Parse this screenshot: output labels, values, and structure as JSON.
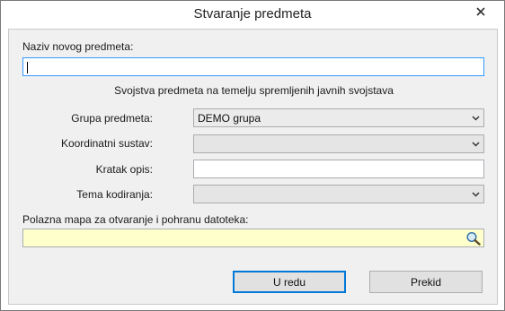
{
  "window": {
    "title": "Stvaranje predmeta"
  },
  "form": {
    "name_label": "Naziv novog predmeta:",
    "name_value": "",
    "properties_heading": "Svojstva predmeta na temelju spremljenih javnih svojstava",
    "group_label": "Grupa predmeta:",
    "group_value": "DEMO grupa",
    "coordinate_label": "Koordinatni sustav:",
    "coordinate_value": "",
    "description_label": "Kratak opis:",
    "description_value": "",
    "coding_label": "Tema kodiranja:",
    "coding_value": "",
    "folder_label": "Polazna mapa za otvaranje i pohranu datoteka:",
    "folder_value": ""
  },
  "buttons": {
    "ok_label": "U redu",
    "cancel_label": "Prekid"
  },
  "icons": {
    "close": "close-icon",
    "dropdown": "chevron-down-icon",
    "browse": "magnifier-icon"
  },
  "colors": {
    "accent": "#3399ff",
    "path_field_bg": "#ffffcc",
    "dialog_bg": "#f0f0f0"
  }
}
